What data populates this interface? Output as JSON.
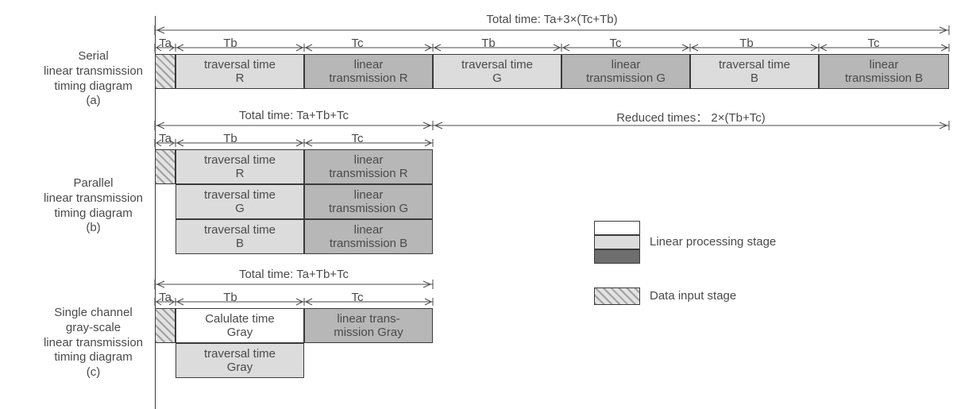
{
  "sections": {
    "a": {
      "title": "Serial\nlinear transmission\ntiming diagram\n(a)",
      "total_label": "Total time: Ta+3×(Tc+Tb)",
      "segments": {
        "ta": "Ta",
        "tb": "Tb",
        "tc": "Tc"
      },
      "blocks": {
        "trav_r": "traversal time\nR",
        "lin_r": "linear\ntransmission R",
        "trav_g": "traversal time\nG",
        "lin_g": "linear\ntransmission G",
        "trav_b": "traversal time\nB",
        "lin_b": "linear\ntransmission B"
      }
    },
    "b": {
      "title": "Parallel\nlinear transmission\ntiming diagram\n(b)",
      "total_label": "Total time: Ta+Tb+Tc",
      "reduced_label": "Reduced times： 2×(Tb+Tc)",
      "segments": {
        "ta": "Ta",
        "tb": "Tb",
        "tc": "Tc"
      },
      "blocks": {
        "trav_r": "traversal time\nR",
        "lin_r": "linear\ntransmission R",
        "trav_g": "traversal time\nG",
        "lin_g": "linear\ntransmission G",
        "trav_b": "traversal time\nB",
        "lin_b": "linear\ntransmission B"
      }
    },
    "c": {
      "title": "Single channel\ngray-scale\nlinear transmission\ntiming diagram\n(c)",
      "total_label": "Total time: Ta+Tb+Tc",
      "segments": {
        "ta": "Ta",
        "tb": "Tb",
        "tc": "Tc"
      },
      "blocks": {
        "calc_gray": "Calulate time\nGray",
        "lin_gray": "linear trans-\nmission Gray",
        "trav_gray": "traversal time\nGray"
      }
    }
  },
  "legend": {
    "linear_stage": "Linear processing stage",
    "data_input": "Data input stage"
  }
}
